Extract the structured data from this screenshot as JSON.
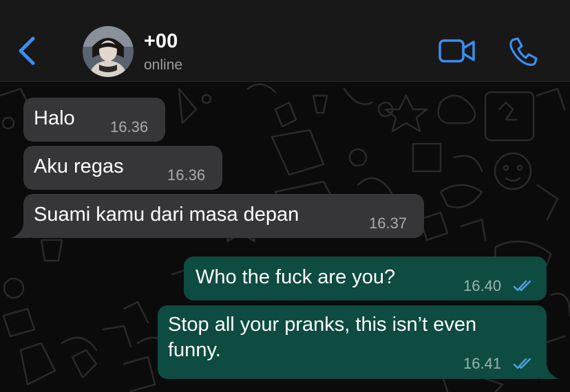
{
  "header": {
    "contact_name": "+00",
    "status": "online",
    "icons": {
      "back": "chevron-left-icon",
      "video": "video-camera-icon",
      "call": "phone-icon"
    },
    "accent_color": "#3b8ef0"
  },
  "messages": [
    {
      "direction": "incoming",
      "text": "Halo",
      "time": "16.36"
    },
    {
      "direction": "incoming",
      "text": "Aku regas",
      "time": "16.36"
    },
    {
      "direction": "incoming",
      "text": "Suami kamu dari masa depan",
      "time": "16.37"
    },
    {
      "direction": "outgoing",
      "text": "Who the fuck are you?",
      "time": "16.40",
      "read": true
    },
    {
      "direction": "outgoing",
      "text_line1": "Stop all your pranks, this isn’t even",
      "text_line2": "funny.",
      "time": "16.41",
      "read": true
    }
  ],
  "colors": {
    "incoming_bubble": "#363638",
    "outgoing_bubble": "#0e4b40",
    "read_ticks": "#4fa3e8"
  }
}
